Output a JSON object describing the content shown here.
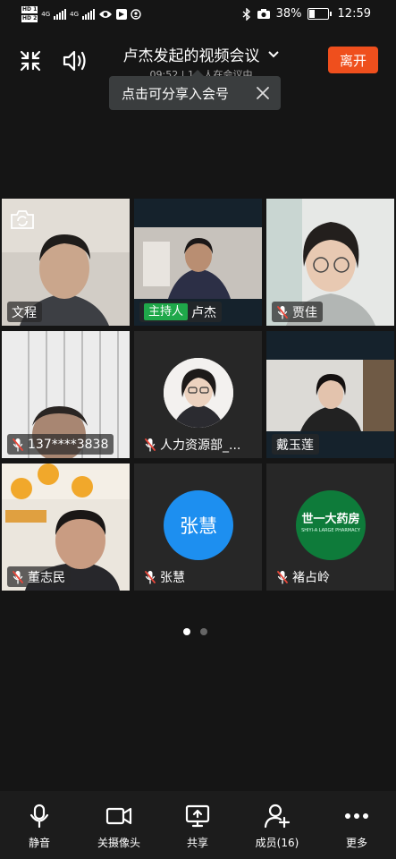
{
  "status_bar": {
    "sim1": "HD 1",
    "sim2": "HD 2",
    "net1": "4G",
    "net2": "4G",
    "battery": "38%",
    "battery_level": 0.38,
    "time": "12:59"
  },
  "header": {
    "title": "卢杰发起的视频会议",
    "subtitle": "09:52 | 14 人在会议中",
    "leave_label": "离开"
  },
  "tooltip": {
    "text": "点击可分享入会号"
  },
  "participants": [
    {
      "name": "文程",
      "muted": false,
      "host": false
    },
    {
      "name": "卢杰",
      "muted": false,
      "host": true,
      "host_label": "主持人"
    },
    {
      "name": "贾佳",
      "muted": true,
      "host": false
    },
    {
      "name": "137****3838",
      "muted": true,
      "host": false
    },
    {
      "name": "人力资源部_...",
      "muted": true,
      "host": false
    },
    {
      "name": "戴玉莲",
      "muted": false,
      "host": false
    },
    {
      "name": "董志民",
      "muted": true,
      "host": false
    },
    {
      "name": "张慧",
      "muted": true,
      "host": false,
      "avatar_text": "张慧"
    },
    {
      "name": "褚占岭",
      "muted": true,
      "host": false,
      "logo_text": "世一大药房",
      "logo_sub": "SHIYI-A LARGE PHARMACY"
    }
  ],
  "pager": {
    "pages": 2,
    "current": 1
  },
  "toolbar": {
    "mute": "静音",
    "camera": "关摄像头",
    "share": "共享",
    "members": "成员(16)",
    "more": "更多"
  },
  "colors": {
    "leave": "#ef4f1d",
    "host_badge": "#1fa84a",
    "mic_off_accent": "#e8473a",
    "avatar_blue": "#1d8ff0",
    "logo_green": "#0e7b3a"
  }
}
